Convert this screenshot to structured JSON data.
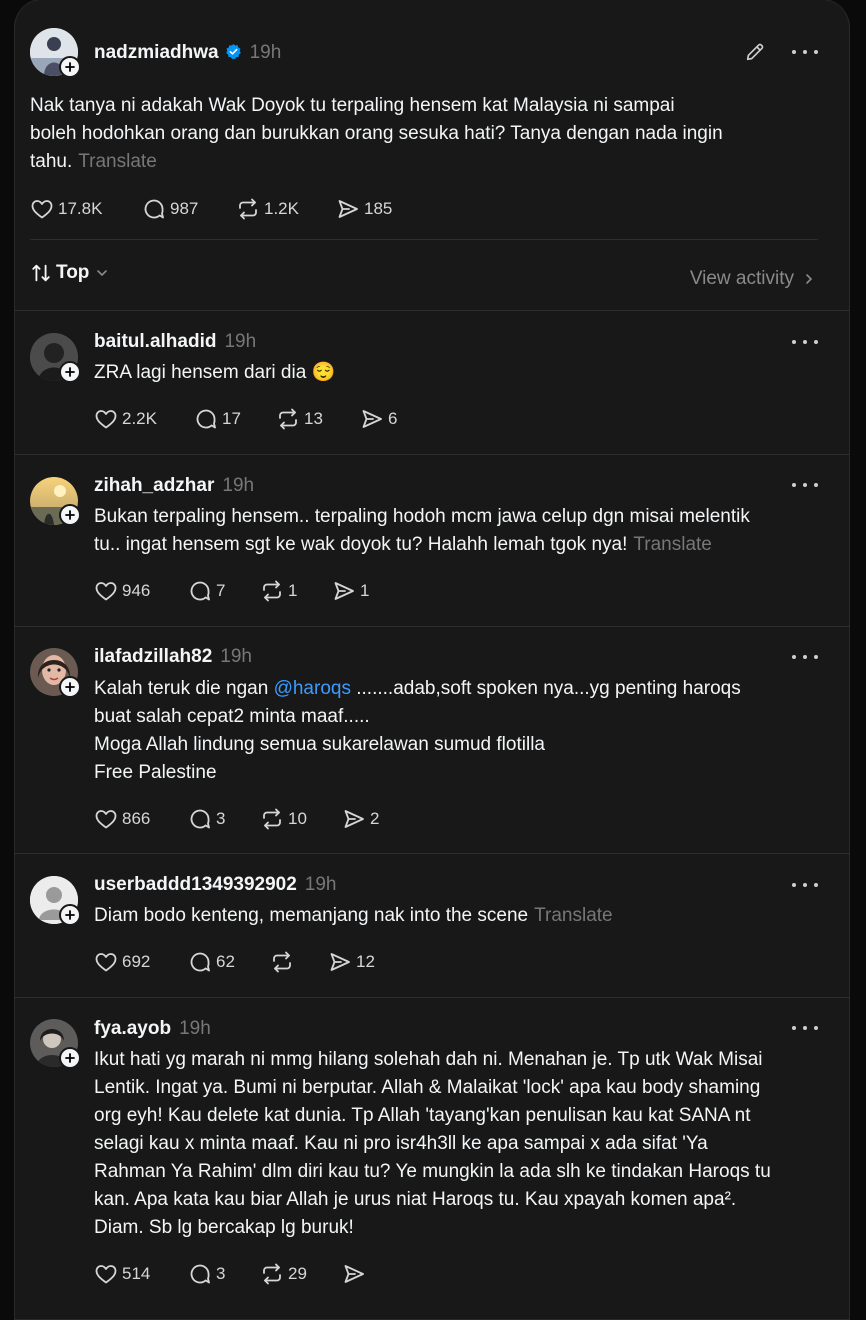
{
  "post": {
    "username": "nadzmiadhwa",
    "time": "19h",
    "text_lines": [
      "Nak tanya ni adakah Wak Doyok tu terpaling hensem kat Malaysia ni sampai",
      "boleh hodohkan orang dan burukkan orang sesuka hati? Tanya dengan nada ingin",
      "tahu."
    ],
    "translate": "Translate",
    "likes": "17.8K",
    "replies": "987",
    "reposts": "1.2K",
    "shares": "185"
  },
  "sort": {
    "label": "Top",
    "view_activity": "View activity"
  },
  "replies": [
    {
      "username": "baitul.alhadid",
      "time": "19h",
      "text_lines": [
        "ZRA lagi hensem dari dia 😌"
      ],
      "likes": "2.2K",
      "replies": "17",
      "reposts": "13",
      "shares": "6"
    },
    {
      "username": "zihah_adzhar",
      "time": "19h",
      "text_lines": [
        "Bukan terpaling hensem.. terpaling hodoh mcm jawa celup dgn misai melentik",
        "tu.. ingat hensem sgt ke wak doyok tu? Halahh lemah tgok nya!"
      ],
      "translate": "Translate",
      "likes": "946",
      "replies": "7",
      "reposts": "1",
      "shares": "1"
    },
    {
      "username": "ilafadzillah82",
      "time": "19h",
      "line1_pre": "Kalah teruk die ngan ",
      "mention": "@haroqs",
      "line1_post": " .......adab,soft spoken nya...yg penting haroqs",
      "text_lines": [
        "buat salah cepat2 minta maaf.....",
        "Moga Allah lindung semua sukarelawan sumud flotilla",
        "Free Palestine"
      ],
      "likes": "866",
      "replies": "3",
      "reposts": "10",
      "shares": "2"
    },
    {
      "username": "userbaddd1349392902",
      "time": "19h",
      "text_lines": [
        "Diam bodo kenteng, memanjang nak into the scene"
      ],
      "translate": "Translate",
      "likes": "692",
      "replies": "62",
      "reposts": "",
      "shares": "12"
    },
    {
      "username": "fya.ayob",
      "time": "19h",
      "text_lines": [
        "Ikut hati yg marah ni mmg hilang solehah dah ni. Menahan je. Tp utk Wak Misai",
        "Lentik. Ingat ya. Bumi ni berputar. Allah & Malaikat 'lock' apa kau body shaming",
        "org eyh! Kau delete kat dunia. Tp Allah 'tayang'kan penulisan kau kat SANA nt",
        "selagi kau x minta maaf. Kau ni pro isr4h3ll ke apa sampai x ada sifat 'Ya",
        "Rahman Ya Rahim' dlm diri kau tu? Ye mungkin la ada slh ke tindakan Haroqs tu",
        "kan. Apa kata kau biar Allah je urus niat Haroqs tu. Kau xpayah komen apa².",
        "Diam. Sb lg bercakap lg buruk!"
      ],
      "likes": "514",
      "replies": "3",
      "reposts": "29",
      "shares": ""
    }
  ],
  "colors": {
    "background": "#181818",
    "text": "#f3f5f7",
    "muted": "#777777",
    "link": "#3c9bff",
    "verified": "#0095f6"
  }
}
